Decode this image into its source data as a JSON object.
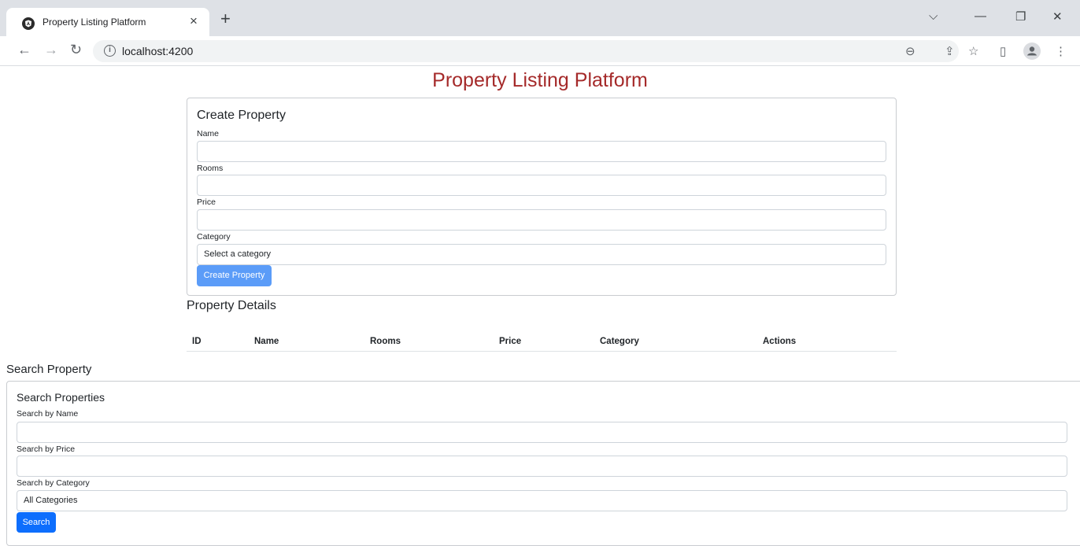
{
  "browser": {
    "tab_title": "Property Listing Platform",
    "tab_close": "×",
    "new_tab": "+",
    "url": "localhost:4200",
    "controls": {
      "dropdown": "⌵",
      "minimize": "—",
      "restore": "❐",
      "close": "✕"
    },
    "nav": {
      "back": "←",
      "forward": "→",
      "reload": "↻"
    },
    "tools": {
      "zoom": "⊖",
      "share": "⇪",
      "bookmark": "☆",
      "sidepanel": "▯",
      "menu": "⋮"
    }
  },
  "page": {
    "title": "Property Listing Platform"
  },
  "create_form": {
    "title": "Create Property",
    "name_label": "Name",
    "rooms_label": "Rooms",
    "price_label": "Price",
    "category_label": "Category",
    "category_value": "Select a category",
    "submit_label": "Create Property"
  },
  "details": {
    "title": "Property Details",
    "columns": [
      "ID",
      "Name",
      "Rooms",
      "Price",
      "Category",
      "Actions"
    ]
  },
  "search_section": {
    "heading": "Search Property",
    "title": "Search Properties",
    "name_label": "Search by Name",
    "price_label": "Search by Price",
    "category_label": "Search by Category",
    "category_value": "All Categories",
    "button_label": "Search"
  },
  "colors": {
    "title": "#a52a2a",
    "primary": "#0d6efd",
    "primary_light": "#5b9cf8"
  }
}
